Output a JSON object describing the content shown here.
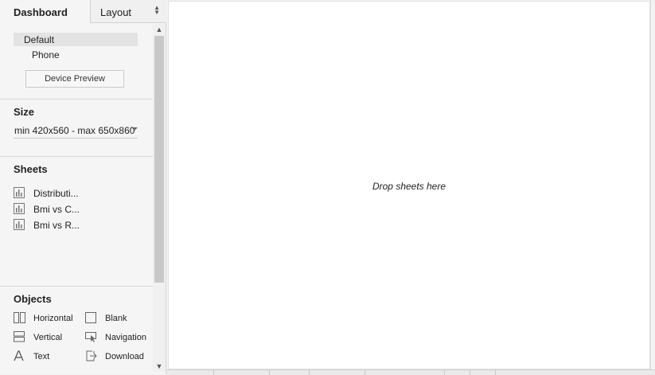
{
  "tabs": {
    "dashboard_label": "Dashboard",
    "layout_label": "Layout"
  },
  "device": {
    "items": [
      {
        "label": "Default",
        "selected": true
      },
      {
        "label": "Phone",
        "selected": false
      }
    ],
    "preview_button": "Device Preview"
  },
  "size": {
    "title": "Size",
    "selected": "min 420x560 - max 650x860"
  },
  "sheets": {
    "title": "Sheets",
    "items": [
      {
        "label": "Distributi...",
        "icon": "bar-chart-icon"
      },
      {
        "label": "Bmi vs C...",
        "icon": "bar-chart-icon"
      },
      {
        "label": "Bmi vs R...",
        "icon": "bar-chart-icon"
      }
    ]
  },
  "objects": {
    "title": "Objects",
    "items": [
      {
        "label": "Horizontal",
        "icon": "horizontal-container-icon"
      },
      {
        "label": "Blank",
        "icon": "blank-icon"
      },
      {
        "label": "Vertical",
        "icon": "vertical-container-icon"
      },
      {
        "label": "Navigation",
        "icon": "navigation-icon"
      },
      {
        "label": "Text",
        "icon": "text-icon"
      },
      {
        "label": "Download",
        "icon": "download-icon"
      }
    ]
  },
  "canvas": {
    "drop_hint": "Drop sheets here"
  }
}
